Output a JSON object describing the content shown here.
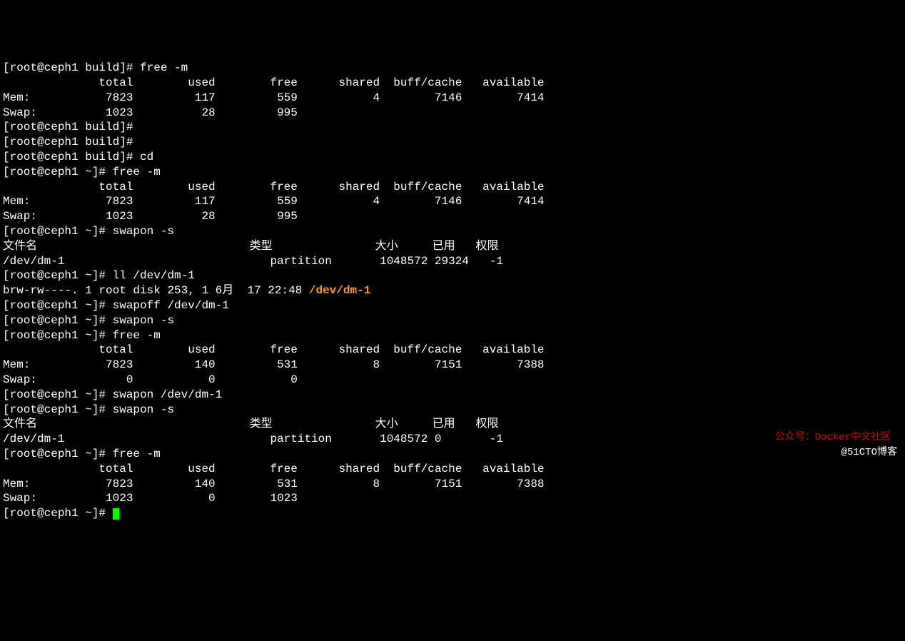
{
  "prompts": {
    "build": "[root@ceph1 build]# ",
    "home": "[root@ceph1 ~]# "
  },
  "cmds": {
    "free": "free -m",
    "cd": "cd",
    "swapon_s": "swapon -s",
    "ll": "ll /dev/dm-1",
    "swapoff": "swapoff /dev/dm-1",
    "swapon_dm": "swapon /dev/dm-1"
  },
  "free_header": "              total        used        free      shared  buff/cache   available",
  "free1": {
    "mem": "Mem:           7823         117         559           4        7146        7414",
    "swap": "Swap:          1023          28         995"
  },
  "free2": {
    "mem": "Mem:           7823         117         559           4        7146        7414",
    "swap": "Swap:          1023          28         995"
  },
  "free3": {
    "mem": "Mem:           7823         140         531           8        7151        7388",
    "swap": "Swap:             0           0           0"
  },
  "free4": {
    "mem": "Mem:           7823         140         531           8        7151        7388",
    "swap": "Swap:          1023           0        1023"
  },
  "swapon_header": "文件名                               类型               大小     已用   权限",
  "swapon1": "/dev/dm-1                              partition       1048572 29324   -1",
  "swapon2": "/dev/dm-1                              partition       1048572 0       -1",
  "ll_out_pre": "brw-rw----. 1 root disk 253, 1 6月  17 22:48 ",
  "ll_out_path": "/dev/dm-1",
  "watermark_red": "公众号：Docker中文社区",
  "watermark_white": "@51CTO博客"
}
